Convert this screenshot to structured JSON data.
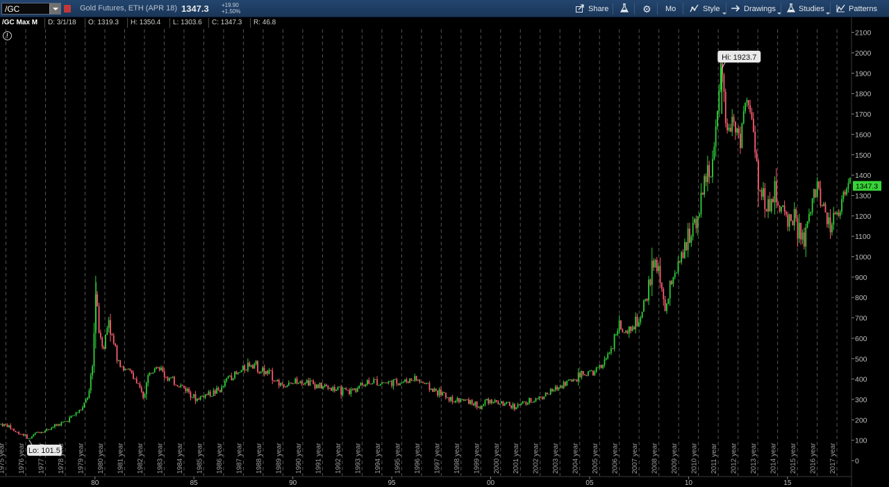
{
  "toolbar": {
    "symbol_value": "/GC",
    "instrument_desc": "Gold Futures, ETH (APR 18)",
    "last_price": "1347.3",
    "net_change": "+19.90",
    "pct_change": "+1.50%",
    "share_label": "Share",
    "mode_label": "Mo",
    "style_label": "Style",
    "drawings_label": "Drawings",
    "studies_label": "Studies",
    "patterns_label": "Patterns",
    "icons": [
      "share-icon",
      "flask-icon",
      "gear-icon",
      "style-icon",
      "drawings-arrow-icon",
      "studies-flask-icon",
      "patterns-icon"
    ]
  },
  "infobar": {
    "study_label": "/GC Max M",
    "date": "D: 3/1/18",
    "open": "O: 1319.3",
    "high": "H: 1350.4",
    "low": "L: 1303.6",
    "close": "C: 1347.3",
    "range": "R: 46.8"
  },
  "colors": {
    "up": "#2fd23a",
    "down": "#ff5c72",
    "background": "#000000",
    "grid": "#6a6a6a",
    "price_tag": "#38d438"
  },
  "chart_data": {
    "type": "candlestick",
    "title": "",
    "xlabel": "",
    "ylabel": "",
    "ylim": [
      0,
      2100
    ],
    "y_ticks": [
      0,
      100,
      200,
      300,
      400,
      500,
      600,
      700,
      800,
      900,
      1000,
      1100,
      1200,
      1300,
      1400,
      1500,
      1600,
      1700,
      1800,
      1900,
      2000,
      2100
    ],
    "xlim": [
      1975.2,
      2018.2
    ],
    "year_labels": [
      "1975 year",
      "1976 year",
      "1977 year",
      "1978 year",
      "1979 year",
      "1980 year",
      "1981 year",
      "1982 year",
      "1983 year",
      "1984 year",
      "1985 year",
      "1986 year",
      "1987 year",
      "1988 year",
      "1989 year",
      "1990 year",
      "1991 year",
      "1992 year",
      "1993 year",
      "1994 year",
      "1995 year",
      "1996 year",
      "1997 year",
      "1998 year",
      "1999 year",
      "2000 year",
      "2001 year",
      "2002 year",
      "2003 year",
      "2004 year",
      "2005 year",
      "2006 year",
      "2007 year",
      "2008 year",
      "2009 year",
      "2010 year",
      "2011 year",
      "2012 year",
      "2013 year",
      "2014 year",
      "2015 year",
      "2016 year",
      "2017 year"
    ],
    "year_label_start": 1975,
    "major_ticks": [
      {
        "year": 1980,
        "label": "80"
      },
      {
        "year": 1985,
        "label": "85"
      },
      {
        "year": 1990,
        "label": "90"
      },
      {
        "year": 1995,
        "label": "95"
      },
      {
        "year": 2000,
        "label": "00"
      },
      {
        "year": 2005,
        "label": "05"
      },
      {
        "year": 2010,
        "label": "10"
      },
      {
        "year": 2015,
        "label": "15"
      }
    ],
    "high_label": "Hi: 1923.7",
    "high_point": {
      "x": 2011.68,
      "y": 1923.7
    },
    "low_label": "Lo: 101.5",
    "low_point": {
      "x": 1976.67,
      "y": 101.5
    },
    "last_price_label": "1347.3",
    "last_price": 1347.3,
    "price_path": [
      [
        1975.2,
        180
      ],
      [
        1975.6,
        170
      ],
      [
        1976.0,
        140
      ],
      [
        1976.4,
        128
      ],
      [
        1976.67,
        105
      ],
      [
        1977.0,
        135
      ],
      [
        1977.5,
        148
      ],
      [
        1978.0,
        172
      ],
      [
        1978.5,
        190
      ],
      [
        1979.0,
        228
      ],
      [
        1979.4,
        260
      ],
      [
        1979.7,
        330
      ],
      [
        1979.9,
        480
      ],
      [
        1980.05,
        870
      ],
      [
        1980.2,
        640
      ],
      [
        1980.45,
        560
      ],
      [
        1980.7,
        700
      ],
      [
        1980.85,
        600
      ],
      [
        1981.1,
        520
      ],
      [
        1981.5,
        440
      ],
      [
        1981.9,
        430
      ],
      [
        1982.2,
        360
      ],
      [
        1982.45,
        310
      ],
      [
        1982.75,
        440
      ],
      [
        1983.1,
        480
      ],
      [
        1983.5,
        420
      ],
      [
        1983.9,
        390
      ],
      [
        1984.3,
        370
      ],
      [
        1984.7,
        345
      ],
      [
        1985.1,
        300
      ],
      [
        1985.5,
        320
      ],
      [
        1985.9,
        330
      ],
      [
        1986.4,
        350
      ],
      [
        1986.8,
        420
      ],
      [
        1987.2,
        420
      ],
      [
        1987.6,
        460
      ],
      [
        1987.95,
        485
      ],
      [
        1988.4,
        440
      ],
      [
        1988.9,
        420
      ],
      [
        1989.3,
        380
      ],
      [
        1989.9,
        370
      ],
      [
        1990.3,
        400
      ],
      [
        1990.8,
        385
      ],
      [
        1991.3,
        365
      ],
      [
        1991.8,
        360
      ],
      [
        1992.3,
        345
      ],
      [
        1992.8,
        335
      ],
      [
        1993.3,
        360
      ],
      [
        1993.8,
        390
      ],
      [
        1994.3,
        385
      ],
      [
        1994.8,
        383
      ],
      [
        1995.3,
        385
      ],
      [
        1995.7,
        388
      ],
      [
        1996.1,
        405
      ],
      [
        1996.6,
        380
      ],
      [
        1997.0,
        350
      ],
      [
        1997.5,
        330
      ],
      [
        1998.0,
        300
      ],
      [
        1998.5,
        295
      ],
      [
        1999.0,
        288
      ],
      [
        1999.5,
        258
      ],
      [
        1999.8,
        300
      ],
      [
        2000.2,
        290
      ],
      [
        2000.7,
        275
      ],
      [
        2001.2,
        265
      ],
      [
        2001.7,
        280
      ],
      [
        2002.2,
        300
      ],
      [
        2002.7,
        320
      ],
      [
        2003.2,
        345
      ],
      [
        2003.7,
        380
      ],
      [
        2004.2,
        400
      ],
      [
        2004.7,
        430
      ],
      [
        2005.2,
        430
      ],
      [
        2005.7,
        470
      ],
      [
        2006.2,
        580
      ],
      [
        2006.4,
        680
      ],
      [
        2006.8,
        600
      ],
      [
        2007.2,
        660
      ],
      [
        2007.6,
        690
      ],
      [
        2007.95,
        830
      ],
      [
        2008.2,
        980
      ],
      [
        2008.6,
        880
      ],
      [
        2008.85,
        730
      ],
      [
        2009.2,
        920
      ],
      [
        2009.6,
        960
      ],
      [
        2010.0,
        1100
      ],
      [
        2010.5,
        1230
      ],
      [
        2010.9,
        1390
      ],
      [
        2011.3,
        1500
      ],
      [
        2011.68,
        1900
      ],
      [
        2011.9,
        1650
      ],
      [
        2012.2,
        1700
      ],
      [
        2012.6,
        1580
      ],
      [
        2012.9,
        1780
      ],
      [
        2013.2,
        1650
      ],
      [
        2013.45,
        1420
      ],
      [
        2013.7,
        1300
      ],
      [
        2014.0,
        1250
      ],
      [
        2014.4,
        1320
      ],
      [
        2014.8,
        1200
      ],
      [
        2015.2,
        1200
      ],
      [
        2015.6,
        1120
      ],
      [
        2015.85,
        1060
      ],
      [
        2016.1,
        1200
      ],
      [
        2016.45,
        1340
      ],
      [
        2016.9,
        1230
      ],
      [
        2017.2,
        1150
      ],
      [
        2017.5,
        1250
      ],
      [
        2017.9,
        1290
      ],
      [
        2018.1,
        1340
      ],
      [
        2018.2,
        1347
      ]
    ]
  }
}
